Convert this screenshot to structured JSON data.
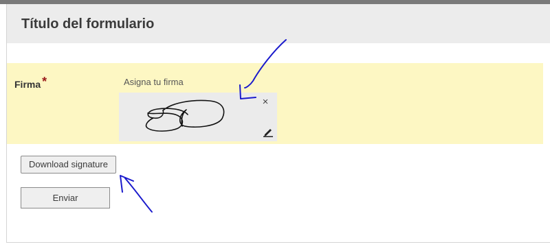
{
  "form": {
    "title": "Título del formulario"
  },
  "signature_field": {
    "label": "Firma",
    "required_marker": "*",
    "caption": "Asigna tu firma",
    "clear_icon": "close-icon",
    "edit_icon": "pencil-icon",
    "clear_glyph": "×"
  },
  "buttons": {
    "download_label": "Download signature",
    "submit_label": "Enviar"
  },
  "colors": {
    "top_bar": "#7a7a7a",
    "header_bg": "#ececec",
    "field_highlight": "#fdf7c3",
    "signature_pad_bg": "#ebebeb",
    "required_mark": "#9a1b1b",
    "annotation_ink": "#1a1acc"
  }
}
